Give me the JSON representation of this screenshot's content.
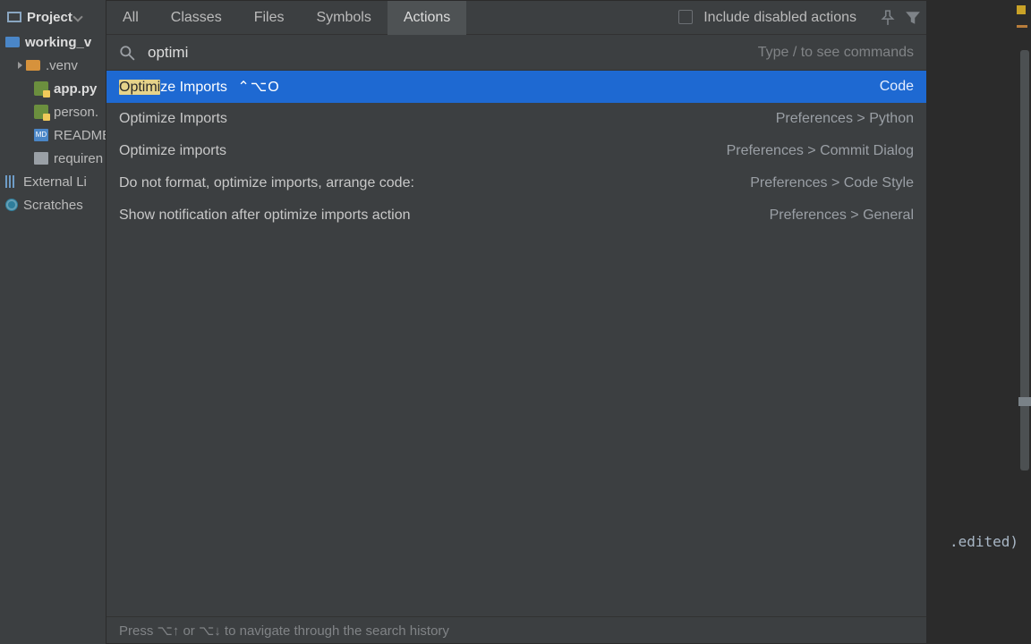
{
  "project": {
    "header": "Project",
    "tree": [
      {
        "label": "working_v",
        "kind": "folder-blue",
        "bold": true,
        "indent": 0
      },
      {
        "label": ".venv",
        "kind": "folder",
        "indent": 1,
        "arrow": true
      },
      {
        "label": "app.py",
        "kind": "py",
        "indent": 2,
        "bold": true
      },
      {
        "label": "person.",
        "kind": "py",
        "indent": 2
      },
      {
        "label": "README",
        "kind": "md",
        "indent": 2
      },
      {
        "label": "requiren",
        "kind": "txt",
        "indent": 2
      },
      {
        "label": "External Li",
        "kind": "lib",
        "indent": 0
      },
      {
        "label": "Scratches",
        "kind": "scratch",
        "indent": 0
      }
    ]
  },
  "code": {
    "snip": ".edited)"
  },
  "popup": {
    "tabs": [
      "All",
      "Classes",
      "Files",
      "Symbols",
      "Actions"
    ],
    "active_tab": 4,
    "include_disabled": "Include disabled actions",
    "search_value": "optimi",
    "hint": "Type / to see commands",
    "results": [
      {
        "prefix_hl": "Optimi",
        "rest": "ze Imports",
        "shortcut": "⌃⌥O",
        "right": "Code",
        "selected": true
      },
      {
        "left": "Optimize Imports",
        "right": "Preferences > Python"
      },
      {
        "left": "Optimize imports",
        "right": "Preferences > Commit Dialog"
      },
      {
        "left": "Do not format, optimize imports, arrange code:",
        "right": "Preferences > Code Style"
      },
      {
        "left": "Show notification after optimize imports action",
        "right": "Preferences > General"
      }
    ],
    "footer": "Press ⌥↑ or ⌥↓ to navigate through the search history"
  }
}
